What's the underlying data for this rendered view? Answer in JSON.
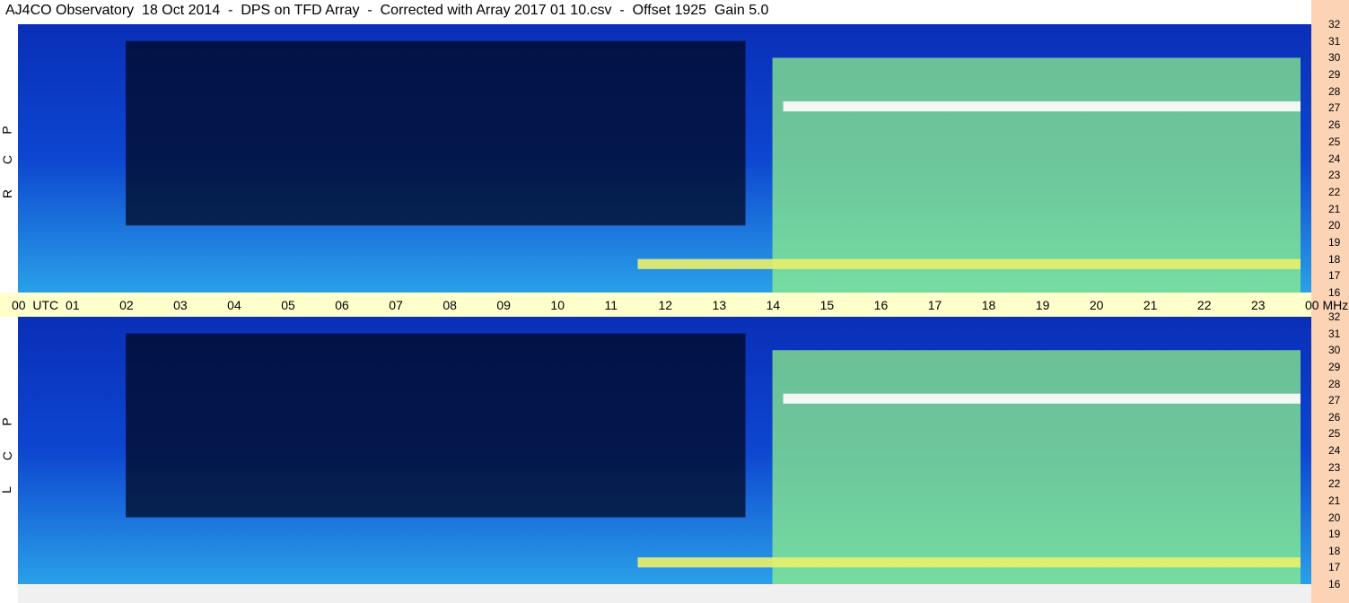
{
  "title": "AJ4CO Observatory  18 Oct 2014  -  DPS on TFD Array  -  Corrected with Array 2017 01 10.csv  -  Offset 1925  Gain 5.0",
  "chart_data": [
    {
      "type": "heatmap",
      "panel": "RCP",
      "polarization_label": [
        "R",
        "C",
        "P"
      ],
      "x_axis": {
        "label": "UTC",
        "range": [
          0,
          24
        ],
        "ticks": [
          "00",
          "01",
          "02",
          "03",
          "04",
          "05",
          "06",
          "07",
          "08",
          "09",
          "10",
          "11",
          "12",
          "13",
          "14",
          "15",
          "16",
          "17",
          "18",
          "19",
          "20",
          "21",
          "22",
          "23",
          "00"
        ]
      },
      "y_axis": {
        "label": "MHz",
        "range": [
          16,
          32
        ],
        "ticks": [
          "32",
          "31",
          "30",
          "29",
          "28",
          "27",
          "26",
          "25",
          "24",
          "23",
          "22",
          "21",
          "20",
          "19",
          "18",
          "17",
          "16"
        ]
      },
      "colormap": [
        "#000822",
        "#001a6e",
        "#0b3fc9",
        "#1a84e6",
        "#27c9d6",
        "#8ef08a",
        "#eaf06a",
        "#ff3fd0",
        "#ffffff"
      ],
      "features": [
        {
          "desc": "night low-signal region",
          "utc_start": 2.0,
          "utc_end": 13.5,
          "mhz_low": 20,
          "mhz_high": 31,
          "level": 0.05
        },
        {
          "desc": "daytime high-signal region",
          "utc_start": 14.0,
          "utc_end": 23.8,
          "mhz_low": 16,
          "mhz_high": 30,
          "level": 0.6
        },
        {
          "desc": "bright band",
          "utc_start": 14.2,
          "utc_end": 23.8,
          "mhz_low": 26.8,
          "mhz_high": 27.4,
          "level": 1.0
        },
        {
          "desc": "bright band",
          "utc_start": 11.5,
          "utc_end": 23.8,
          "mhz_low": 17.4,
          "mhz_high": 18.0,
          "level": 0.8
        }
      ]
    },
    {
      "type": "heatmap",
      "panel": "LCP",
      "polarization_label": [
        "L",
        "C",
        "P"
      ],
      "x_axis": {
        "label": "UTC",
        "range": [
          0,
          24
        ]
      },
      "y_axis": {
        "label": "MHz",
        "range": [
          16,
          32
        ],
        "ticks": [
          "32",
          "31",
          "30",
          "29",
          "28",
          "27",
          "26",
          "25",
          "24",
          "23",
          "22",
          "21",
          "20",
          "19",
          "18",
          "17",
          "16"
        ]
      },
      "colormap": [
        "#000822",
        "#001a6e",
        "#0b3fc9",
        "#1a84e6",
        "#27c9d6",
        "#8ef08a",
        "#eaf06a",
        "#ff3fd0",
        "#ffffff"
      ],
      "features": [
        {
          "desc": "night low-signal region",
          "utc_start": 2.0,
          "utc_end": 13.5,
          "mhz_low": 20,
          "mhz_high": 31,
          "level": 0.05
        },
        {
          "desc": "daytime high-signal region",
          "utc_start": 14.0,
          "utc_end": 23.8,
          "mhz_low": 16,
          "mhz_high": 30,
          "level": 0.6
        },
        {
          "desc": "bright band",
          "utc_start": 14.2,
          "utc_end": 23.8,
          "mhz_low": 26.8,
          "mhz_high": 27.4,
          "level": 1.0
        },
        {
          "desc": "bright band",
          "utc_start": 11.5,
          "utc_end": 23.8,
          "mhz_low": 17.0,
          "mhz_high": 17.6,
          "level": 0.8
        }
      ]
    }
  ],
  "x_axis_title": "UTC",
  "y_axis_unit": "MHz"
}
